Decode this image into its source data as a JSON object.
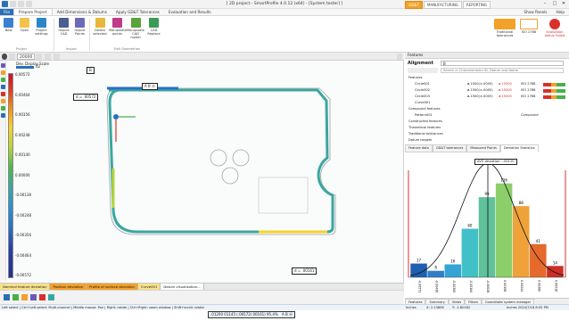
{
  "window": {
    "title": "[ 2D project - SmartProfile 4.0.12 (x64) - [System tester] ]",
    "modes": [
      "GD&T",
      "MANUFACTURING",
      "REPORTING"
    ],
    "active_mode": "GD&T"
  },
  "ribbon": {
    "tabs": [
      "File",
      "Prepare Project",
      "Add Dimensions & Datums",
      "Apply GD&T Tolerances",
      "Evaluation and Results"
    ],
    "show_panels": "Show Panels",
    "help": "Help",
    "buttons": {
      "new": "New",
      "open": "Open",
      "project_settings": "Project settings",
      "import_cad": "Import CAD",
      "import_points": "Import Points",
      "delete_selected": "Delete selected",
      "manipulate_points": "Manipulate points",
      "manipulate_cad": "Manipulate CAD model",
      "cad_replace": "CAD Replace",
      "traditional": "Traditional tolerances",
      "iso_tol": "ISO 2768",
      "eval_status": "Evaluation status Failed"
    },
    "groups": {
      "project": "Project",
      "import": "Import",
      "edit_geometries": "Edit Geometries"
    }
  },
  "view": {
    "zoom": "20000",
    "dev_scale_title": "Dev. Display Scale",
    "dev_scale_value": "02",
    "scale_ticks": [
      "0.00572",
      "0.00464",
      "0.00356",
      "0.00248",
      "0.00140",
      "0.00000",
      "-0.00138",
      "-0.00248",
      "-0.00356",
      "-0.00464",
      "-0.00572"
    ],
    "datum_b": "B",
    "callout_top": "d = .00572",
    "callout_right": "d = .00161",
    "fcf_top": "A  B ⓜ",
    "fcf_bottom_value": ".01200 01145 (.00572/.00161) 95.4%",
    "fcf_bottom_refs": "A  B ⓜ",
    "axis_y": "Y",
    "axis_x": "X"
  },
  "status_tabs": [
    "Nominal feature deviation",
    "Position deviation",
    "Profile of surface deviation",
    "Curve001",
    "Datum visualization..."
  ],
  "statusbar": {
    "left": "Left select | Ctrl+Left select: Multi-channel | Middle mouse: Pan | Right: rotate | Ctrl+Right: zoom window | Shift+scroll: rotate",
    "units": "Inches",
    "x": "X: 2.13806",
    "y": "Y: -1.80182",
    "license": "Inches  2024/7/18 8:55 PM"
  },
  "features_panel": {
    "title": "Features",
    "alignment_label": "Alignment",
    "alignment_value": "B",
    "search_placeholder": "Search in Characteristics ID, Datum and Name",
    "tree": [
      {
        "label": "Features",
        "indent": 0
      },
      {
        "label": "Circle001",
        "indent": 1,
        "tol": "ø.1500(±.0005)",
        "val": "ø.15000",
        "status": "ISO 2768"
      },
      {
        "label": "Circle002",
        "indent": 1,
        "tol": "ø.1500(±.0005)",
        "val": "ø.15000",
        "status": "ISO 2768"
      },
      {
        "label": "Circle003",
        "indent": 1,
        "tol": "ø.1500(±.0005)",
        "val": "ø.15000",
        "status": "ISO 2768"
      },
      {
        "label": "Curve001",
        "indent": 1
      },
      {
        "label": "Compound features",
        "indent": 0
      },
      {
        "label": "Pattern001",
        "indent": 1,
        "status": "Compound"
      },
      {
        "label": "Constructed features",
        "indent": 0
      },
      {
        "label": "Theoretical features",
        "indent": 0
      },
      {
        "label": "Traditional tolerances",
        "indent": 0
      },
      {
        "label": "Datum targets",
        "indent": 0
      }
    ]
  },
  "stats_panel": {
    "tabs": [
      "Feature data",
      "GD&T tolerances",
      "Measured Points",
      "Deviation Statistics"
    ],
    "active_tab": "Deviation Statistics",
    "hist_caption": "AVG deviation: -.00120",
    "bottom_tabs": [
      "Features",
      "Summary",
      "Views",
      "Filters",
      "Coordinate system manager"
    ]
  },
  "chart_data": {
    "type": "bar",
    "categories": [
      "-0.00572",
      "-0.00436",
      "-0.00300",
      "-0.00164",
      "-0.00028",
      "0.00108",
      "0.00244",
      "0.00380",
      "0.00516"
    ],
    "values": [
      17,
      8,
      16,
      60,
      99,
      116,
      88,
      41,
      14
    ],
    "bar_colors": [
      "#1f5fb0",
      "#2f7fc8",
      "#36a3d6",
      "#42c0c8",
      "#5fc29a",
      "#8ccf6a",
      "#f0a23a",
      "#e56a2c",
      "#cc2d25"
    ],
    "curve": "normal distribution overlay",
    "limits_red": true
  },
  "colors": {
    "accent": "#f2a12a",
    "file_tab": "#2a6fb8",
    "fail": "#d9302c",
    "pass": "#48b04a"
  }
}
